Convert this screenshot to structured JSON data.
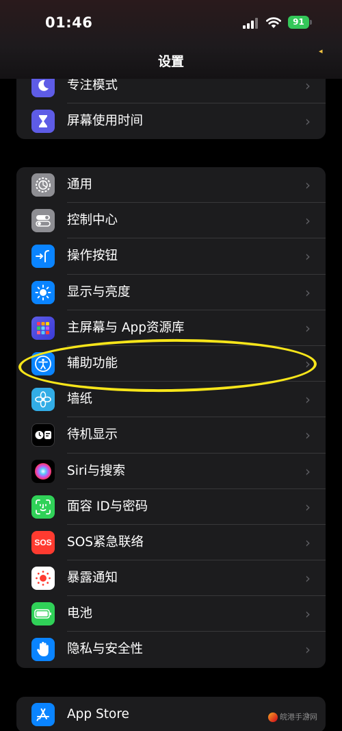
{
  "status": {
    "time": "01:46",
    "battery": "91"
  },
  "nav": {
    "title": "设置"
  },
  "groups": [
    {
      "rows": [
        {
          "label": "专注模式",
          "icon": "moon-icon",
          "color": "#5e5ce6"
        },
        {
          "label": "屏幕使用时间",
          "icon": "hourglass-icon",
          "color": "#5e5ce6"
        }
      ]
    },
    {
      "rows": [
        {
          "label": "通用",
          "icon": "gear-icon",
          "color": "#8e8e93"
        },
        {
          "label": "控制中心",
          "icon": "toggles-icon",
          "color": "#8e8e93"
        },
        {
          "label": "操作按钮",
          "icon": "action-button-icon",
          "color": "#0a84ff"
        },
        {
          "label": "显示与亮度",
          "icon": "sun-icon",
          "color": "#0a84ff"
        },
        {
          "label": "主屏幕与 App资源库",
          "icon": "app-grid-icon",
          "color": "#5e5ce6"
        },
        {
          "label": "辅助功能",
          "icon": "accessibility-icon",
          "color": "#0a84ff"
        },
        {
          "label": "墙纸",
          "icon": "flower-icon",
          "color": "#32ade6"
        },
        {
          "label": "待机显示",
          "icon": "standby-icon",
          "color": "#000000"
        },
        {
          "label": "Siri与搜索",
          "icon": "siri-icon",
          "color": "#1c1c1e"
        },
        {
          "label": "面容 ID与密码",
          "icon": "face-id-icon",
          "color": "#30d158"
        },
        {
          "label": "SOS紧急联络",
          "icon": "sos-icon",
          "color": "#ff3b30"
        },
        {
          "label": "暴露通知",
          "icon": "exposure-icon",
          "color": "#ffffff"
        },
        {
          "label": "电池",
          "icon": "battery-icon",
          "color": "#30d158"
        },
        {
          "label": "隐私与安全性",
          "icon": "hand-icon",
          "color": "#0a84ff"
        }
      ]
    },
    {
      "rows": [
        {
          "label": "App Store",
          "icon": "app-store-icon",
          "color": "#0a84ff"
        }
      ]
    }
  ],
  "sos_icon_text": "SOS",
  "watermark": "皖港手游网"
}
